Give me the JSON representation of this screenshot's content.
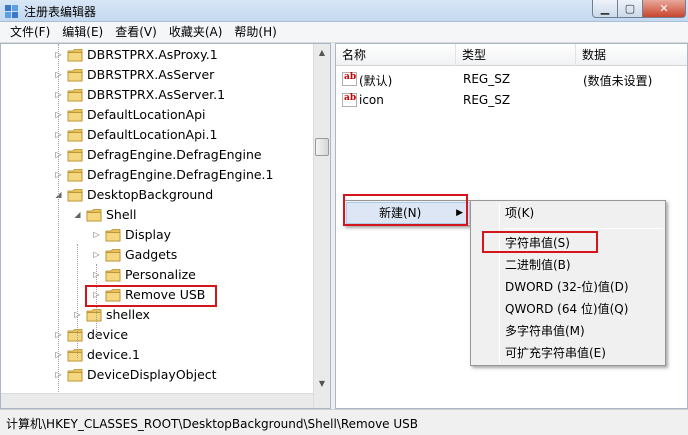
{
  "window": {
    "title": "注册表编辑器"
  },
  "menubar": [
    {
      "label": "文件(F)"
    },
    {
      "label": "编辑(E)"
    },
    {
      "label": "查看(V)"
    },
    {
      "label": "收藏夹(A)"
    },
    {
      "label": "帮助(H)"
    }
  ],
  "tree": {
    "items": [
      {
        "label": "DBRSTPRX.AsProxy.1",
        "depth": 0,
        "expandable": true,
        "expanded": false
      },
      {
        "label": "DBRSTPRX.AsServer",
        "depth": 0,
        "expandable": true,
        "expanded": false
      },
      {
        "label": "DBRSTPRX.AsServer.1",
        "depth": 0,
        "expandable": true,
        "expanded": false
      },
      {
        "label": "DefaultLocationApi",
        "depth": 0,
        "expandable": true,
        "expanded": false
      },
      {
        "label": "DefaultLocationApi.1",
        "depth": 0,
        "expandable": true,
        "expanded": false
      },
      {
        "label": "DefragEngine.DefragEngine",
        "depth": 0,
        "expandable": true,
        "expanded": false
      },
      {
        "label": "DefragEngine.DefragEngine.1",
        "depth": 0,
        "expandable": true,
        "expanded": false
      },
      {
        "label": "DesktopBackground",
        "depth": 0,
        "expandable": true,
        "expanded": true
      },
      {
        "label": "Shell",
        "depth": 1,
        "expandable": true,
        "expanded": true
      },
      {
        "label": "Display",
        "depth": 2,
        "expandable": true,
        "expanded": false
      },
      {
        "label": "Gadgets",
        "depth": 2,
        "expandable": true,
        "expanded": false
      },
      {
        "label": "Personalize",
        "depth": 2,
        "expandable": true,
        "expanded": false
      },
      {
        "label": "Remove USB",
        "depth": 2,
        "expandable": true,
        "expanded": false,
        "highlighted": true
      },
      {
        "label": "shellex",
        "depth": 1,
        "expandable": true,
        "expanded": false
      },
      {
        "label": "device",
        "depth": 0,
        "expandable": true,
        "expanded": false
      },
      {
        "label": "device.1",
        "depth": 0,
        "expandable": true,
        "expanded": false
      },
      {
        "label": "DeviceDisplayObject",
        "depth": 0,
        "expandable": true,
        "expanded": false
      }
    ]
  },
  "list": {
    "columns": [
      "名称",
      "类型",
      "数据"
    ],
    "rows": [
      {
        "name": "(默认)",
        "type": "REG_SZ",
        "data": "(数值未设置)"
      },
      {
        "name": "icon",
        "type": "REG_SZ",
        "data": ""
      }
    ]
  },
  "context_menu": {
    "new_label": "新建(N)",
    "submenu": [
      {
        "label": "项(K)"
      },
      {
        "label": "字符串值(S)",
        "highlighted": true
      },
      {
        "label": "二进制值(B)"
      },
      {
        "label": "DWORD (32-位)值(D)"
      },
      {
        "label": "QWORD (64 位)值(Q)"
      },
      {
        "label": "多字符串值(M)"
      },
      {
        "label": "可扩充字符串值(E)"
      }
    ]
  },
  "status": {
    "path": "计算机\\HKEY_CLASSES_ROOT\\DesktopBackground\\Shell\\Remove USB"
  },
  "colors": {
    "highlight_box": "#d4161c",
    "folder": "#e8c15a"
  }
}
